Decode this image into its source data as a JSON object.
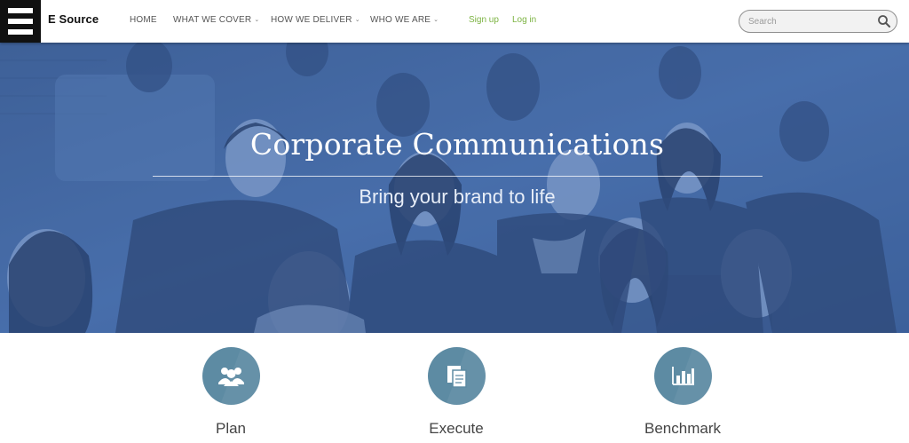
{
  "header": {
    "brand": "E Source",
    "nav": [
      {
        "label": "HOME"
      },
      {
        "label": "WHAT WE COVER"
      },
      {
        "label": "HOW WE DELIVER"
      },
      {
        "label": "WHO WE ARE"
      }
    ],
    "caret_glyph": "⌄",
    "signup_label": "Sign up",
    "login_label": "Log in",
    "search_placeholder": "Search",
    "link_color": "#7cb342"
  },
  "hero": {
    "title": "Corporate Communications",
    "subtitle": "Bring your brand to life",
    "tint_color": "#4a6fa8"
  },
  "features": [
    {
      "label": "Plan",
      "icon": "people-group-icon"
    },
    {
      "label": "Execute",
      "icon": "documents-icon"
    },
    {
      "label": "Benchmark",
      "icon": "bar-chart-icon"
    }
  ],
  "colors": {
    "feature_circle": "#5d8ba3"
  }
}
